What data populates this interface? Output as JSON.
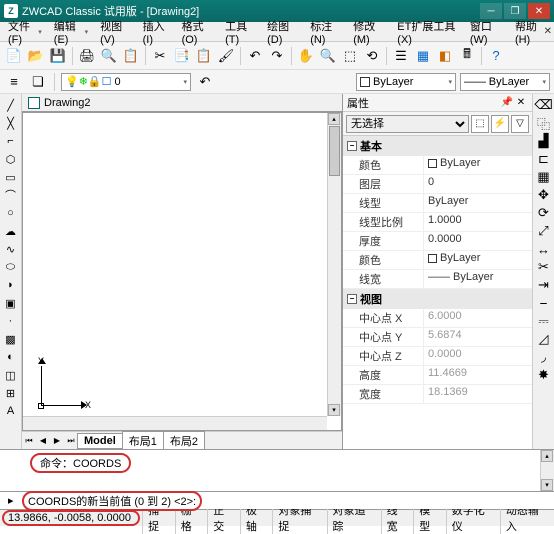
{
  "title": "ZWCAD Classic 试用版 - [Drawing2]",
  "menus": [
    "文件(F)",
    "编辑(E)",
    "视图(V)",
    "插入(I)",
    "格式(O)",
    "工具(T)",
    "绘图(D)",
    "标注(N)",
    "修改(M)",
    "ET扩展工具(X)",
    "窗口(W)",
    "帮助(H)"
  ],
  "doc_tab": "Drawing2",
  "layer_combo": "0",
  "bylayer1": "ByLayer",
  "bylayer2": "ByLayer",
  "axes": {
    "x": "X",
    "y": "Y"
  },
  "model_tabs": [
    "Model",
    "布局1",
    "布局2"
  ],
  "props": {
    "title": "属性",
    "no_sel": "无选择",
    "cats": {
      "basic": "基本",
      "view": "视图"
    },
    "rows_basic": [
      {
        "k": "颜色",
        "v": "ByLayer",
        "sw": "#fff"
      },
      {
        "k": "图层",
        "v": "0"
      },
      {
        "k": "线型",
        "v": "ByLayer"
      },
      {
        "k": "线型比例",
        "v": "1.0000"
      },
      {
        "k": "厚度",
        "v": "0.0000"
      },
      {
        "k": "颜色",
        "v": "ByLayer",
        "sw": "#fff"
      },
      {
        "k": "线宽",
        "v": "—— ByLayer"
      }
    ],
    "rows_view": [
      {
        "k": "中心点 X",
        "v": "6.0000",
        "dis": true
      },
      {
        "k": "中心点 Y",
        "v": "5.6874",
        "dis": true
      },
      {
        "k": "中心点 Z",
        "v": "0.0000",
        "dis": true
      },
      {
        "k": "高度",
        "v": "11.4669",
        "dis": true
      },
      {
        "k": "宽度",
        "v": "18.1369",
        "dis": true
      }
    ]
  },
  "cmd": {
    "line1_prefix": "命令：",
    "line1_cmd": "COORDS",
    "prompt": "COORDS的新当前值 (0 到 2) <2>:"
  },
  "status": {
    "coords": "13.9866, -0.0058, 0.0000",
    "items": [
      "捕捉",
      "栅格",
      "正交",
      "极轴",
      "对象捕捉",
      "对象追踪",
      "线宽",
      "模型",
      "数字化仪",
      "动态输入"
    ]
  }
}
